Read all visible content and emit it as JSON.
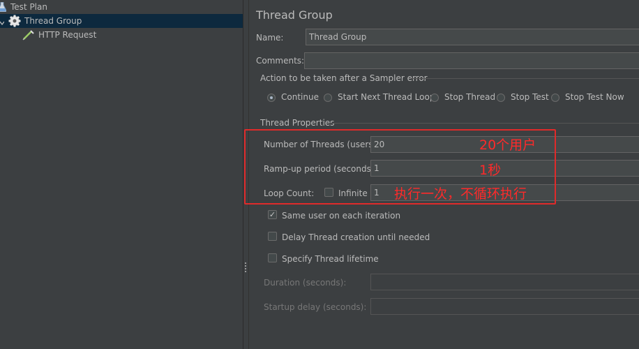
{
  "tree": {
    "items": [
      {
        "label": "Test Plan",
        "icon": "flask-icon"
      },
      {
        "label": "Thread Group",
        "icon": "gear-icon",
        "selected": true
      },
      {
        "label": "HTTP Request",
        "icon": "pipette-icon"
      }
    ]
  },
  "panel": {
    "title": "Thread Group",
    "name_label": "Name:",
    "name_value": "Thread Group",
    "comments_label": "Comments:",
    "comments_value": "",
    "sampler_error": {
      "legend": "Action to be taken after a Sampler error",
      "options": [
        "Continue",
        "Start Next Thread Loop",
        "Stop Thread",
        "Stop Test",
        "Stop Test Now"
      ],
      "selected": "Continue"
    },
    "thread_props": {
      "legend": "Thread Properties",
      "threads_label": "Number of Threads (users):",
      "threads_value": "20",
      "rampup_label": "Ramp-up period (seconds):",
      "rampup_value": "1",
      "loop_label": "Loop Count:",
      "infinite_label": "Infinite",
      "infinite_checked": false,
      "loop_value": "1",
      "same_user_label": "Same user on each iteration",
      "same_user_checked": true,
      "delay_label": "Delay Thread creation until needed",
      "delay_checked": false,
      "lifetime_label": "Specify Thread lifetime",
      "lifetime_checked": false,
      "duration_label": "Duration (seconds):",
      "startup_label": "Startup delay (seconds):"
    }
  },
  "annotations": {
    "threads": "20个用户",
    "rampup": "1秒",
    "loop": "执行一次，不循环执行",
    "color": "#ff2a2a"
  },
  "colors": {
    "background": "#3c3f41",
    "selection": "#0d293e",
    "text": "#bbbbbb",
    "annotation_red": "#e02a2a"
  }
}
